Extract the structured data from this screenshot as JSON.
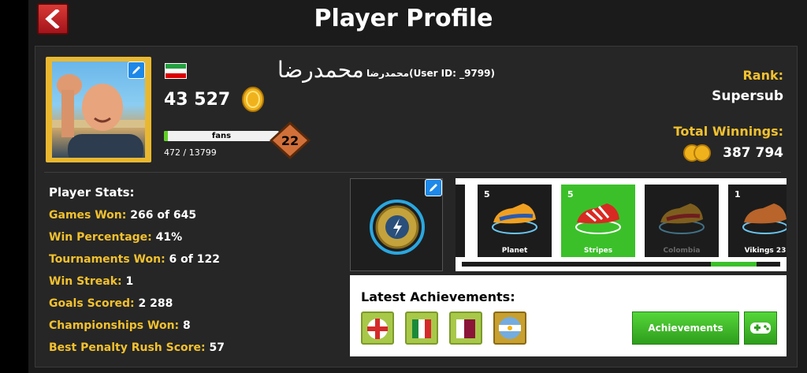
{
  "header": {
    "title": "Player Profile",
    "back_icon": "chevron-left-icon"
  },
  "player": {
    "name": "محمدرضا",
    "user_id_text": "محمدرضا(User ID: _9799)",
    "flag": "iran-flag-icon",
    "coins": "43 527",
    "fans_label": "fans",
    "fans_count": "472 / 13799",
    "fans_progress": 0.034,
    "level": "22"
  },
  "rank": {
    "label": "Rank:",
    "value": "Supersub"
  },
  "winnings": {
    "label": "Total Winnings:",
    "value": "387 794"
  },
  "stats": {
    "title": "Player Stats:",
    "rows": [
      {
        "label": "Games Won:",
        "value": "266 of 645"
      },
      {
        "label": "Win Percentage:",
        "value": "41%"
      },
      {
        "label": "Tournaments Won:",
        "value": "6 of 122"
      },
      {
        "label": "Win Streak:",
        "value": "1"
      },
      {
        "label": "Goals Scored:",
        "value": "2 288"
      },
      {
        "label": "Championships Won:",
        "value": "8"
      },
      {
        "label": "Best Penalty Rush Score:",
        "value": "57"
      }
    ]
  },
  "boots": [
    {
      "count": "5",
      "name": "Planet",
      "selected": false
    },
    {
      "count": "5",
      "name": "Stripes",
      "selected": true
    },
    {
      "count": "",
      "name": "Colombia",
      "selected": false
    },
    {
      "count": "1",
      "name": "Vikings 23",
      "selected": false
    }
  ],
  "achievements": {
    "title": "Latest Achievements:",
    "button_label": "Achievements",
    "icons": [
      "england-flag-achievement-icon",
      "mexico-flag-achievement-icon",
      "qatar-flag-achievement-icon",
      "argentina-flag-achievement-icon"
    ]
  },
  "colors": {
    "accent_yellow": "#f2c12e",
    "green": "#3bc02a",
    "back_red": "#c0242a"
  }
}
